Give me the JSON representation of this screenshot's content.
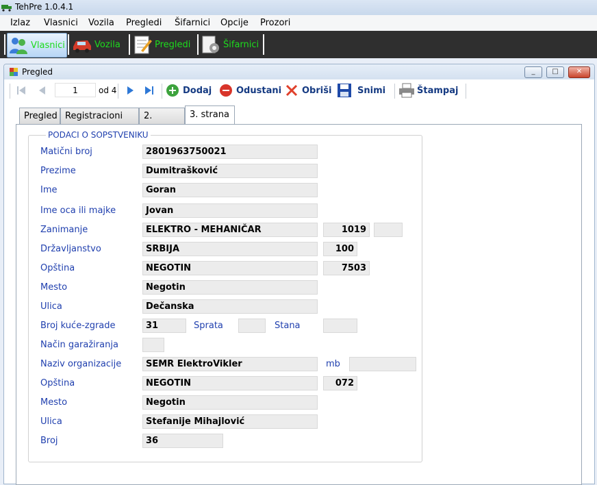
{
  "app": {
    "title": "TehPre 1.0.4.1"
  },
  "menu": [
    "Izlaz",
    "Vlasnici",
    "Vozila",
    "Pregledi",
    "Šifarnici",
    "Opcije",
    "Prozori"
  ],
  "main_toolbar": [
    {
      "label": "Vlasnici",
      "icon": "owners-icon"
    },
    {
      "label": "Vozila",
      "icon": "car-icon"
    },
    {
      "label": "Pregledi",
      "icon": "notepad-icon"
    },
    {
      "label": "Šifarnici",
      "icon": "settings-doc-icon"
    }
  ],
  "window": {
    "title": "Pregled",
    "minimize": "_",
    "maximize": "□",
    "close": "✕"
  },
  "record_toolbar": {
    "position": "1",
    "of_label": "od 4",
    "add": "Dodaj",
    "cancel": "Odustani",
    "delete": "Obriši",
    "save": "Snimi",
    "print": "Štampaj"
  },
  "tabs": [
    "Pregled",
    "Registracioni list",
    "2. strana",
    "3. strana"
  ],
  "active_tab": "3. strana",
  "group": {
    "title": "PODACI O SOPSTVENIKU"
  },
  "form": {
    "maticni_broj": {
      "label": "Matični broj",
      "value": "2801963750021"
    },
    "prezime": {
      "label": "Prezime",
      "value": "Dumitrašković"
    },
    "ime": {
      "label": "Ime",
      "value": "Goran"
    },
    "ime_oca": {
      "label": "Ime oca ili majke",
      "value": "Jovan"
    },
    "zanimanje": {
      "label": "Zanimanje",
      "value": "ELEKTRO - MEHANIČAR",
      "code": "1019",
      "extra": ""
    },
    "drzavljanstvo": {
      "label": "Državljanstvo",
      "value": "SRBIJA",
      "code": "100"
    },
    "opstina": {
      "label": "Opština",
      "value": "NEGOTIN",
      "code": "7503"
    },
    "mesto": {
      "label": "Mesto",
      "value": "Negotin"
    },
    "ulica": {
      "label": "Ulica",
      "value": "Dečanska"
    },
    "broj_kuce": {
      "label": "Broj kuće-zgrade",
      "value": "31",
      "sprata_label": "Sprata",
      "sprata": "",
      "stana_label": "Stana",
      "stana": ""
    },
    "nacin_garaziranja": {
      "label": "Način garažiranja",
      "value": ""
    },
    "naziv_org": {
      "label": "Naziv organizacije",
      "value": "SEMR ElektroVikler",
      "mb_label": "mb",
      "mb": ""
    },
    "org_opstina": {
      "label": "Opština",
      "value": "NEGOTIN",
      "code": "072"
    },
    "org_mesto": {
      "label": "Mesto",
      "value": "Negotin"
    },
    "org_ulica": {
      "label": "Ulica",
      "value": "Stefanije Mihajlović"
    },
    "org_broj": {
      "label": "Broj",
      "value": "36"
    }
  },
  "colors": {
    "label_blue": "#1f3fae",
    "toolbar_green": "#1ddc1d",
    "field_bg": "#ececec"
  }
}
